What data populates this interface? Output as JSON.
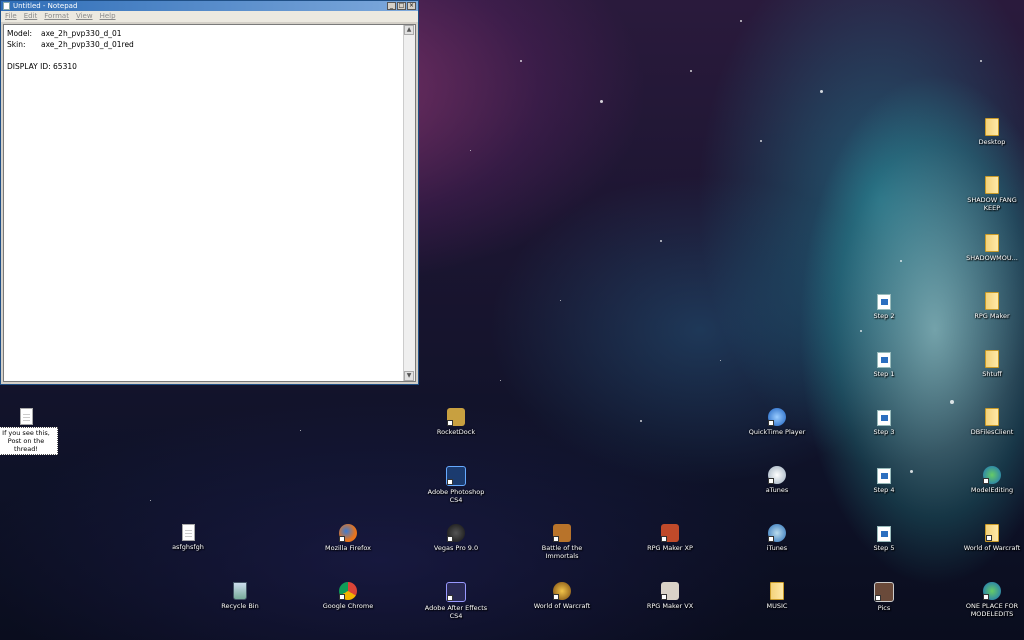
{
  "notepad": {
    "title": "Untitled - Notepad",
    "menu": [
      "File",
      "Edit",
      "Format",
      "View",
      "Help"
    ],
    "lines": [
      {
        "key": "Model:",
        "value": "axe_2h_pvp330_d_01"
      },
      {
        "key": "Skin:",
        "value": "axe_2h_pvp330_d_01red"
      },
      {
        "key": "",
        "value": ""
      },
      {
        "key": "DISPLAY ID: 65310",
        "value": ""
      }
    ],
    "controls": {
      "minimize": "_",
      "maximize": "□",
      "close": "×"
    }
  },
  "desktop_icons": {
    "if_you_see_this": "If you see this, Post on the thread!",
    "rocketdock": "RocketDock",
    "quicktime": "QuickTime Player",
    "photoshop": "Adobe Photoshop CS4",
    "atunes": "aTunes",
    "asfghsfgh": "asfghsfgh",
    "firefox": "Mozilla Firefox",
    "vegas": "Vegas Pro 9.0",
    "battle": "Battle of the Immortals",
    "rpg_xp": "RPG Maker XP",
    "itunes": "iTunes",
    "recycle": "Recycle Bin",
    "chrome": "Google Chrome",
    "after_effects": "Adobe After Effects CS4",
    "wow": "World of Warcraft",
    "rpg_vx": "RPG Maker VX",
    "music": "MUSIC",
    "pics": "Pics",
    "step1": "Step 1",
    "step2": "Step 2",
    "step3": "Step 3",
    "step4": "Step 4",
    "step5": "Step 5",
    "desktop": "Desktop",
    "shadowfang": "SHADOW FANG KEEP",
    "shadowmou": "SHADOWMOU...",
    "rpg_maker": "RPG Maker",
    "shtuff": "Shtuff",
    "dbfiles": "DBFilesClient",
    "modeledit": "ModelEditing",
    "world_of": "World of Warcraft",
    "one_place": "ONE PLACE FOR MODELEDITS"
  }
}
